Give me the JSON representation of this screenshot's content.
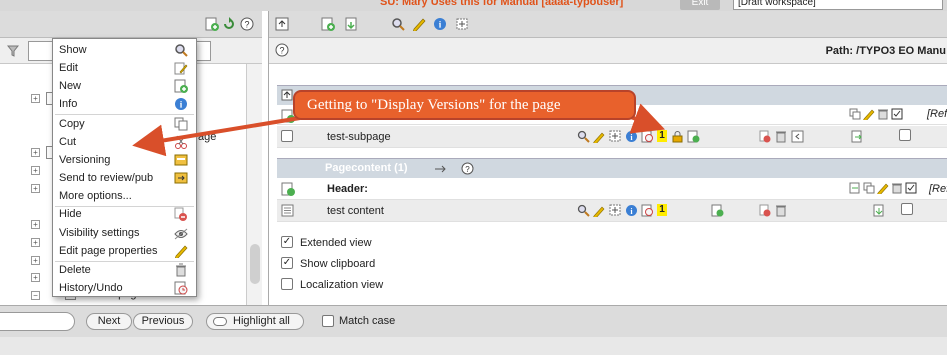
{
  "topbar": {
    "su_label": "SU:  Mary Uses this for Manual [aaaa-typouser]",
    "exit_label": "Exit",
    "workspace": "[Draft workspace]"
  },
  "context_menu": {
    "items": [
      {
        "label": "Show",
        "icon": "magnifier-icon"
      },
      {
        "label": "Edit",
        "icon": "pencil-page-icon"
      },
      {
        "label": "New",
        "icon": "new-page-icon"
      },
      {
        "label": "Info",
        "icon": "info-icon"
      },
      {
        "label": "Copy",
        "icon": "copy-icon"
      },
      {
        "label": "Cut",
        "icon": "scissors-icon"
      },
      {
        "label": "Versioning",
        "icon": "versioning-icon"
      },
      {
        "label": "Send to review/pub",
        "icon": "send-review-icon"
      },
      {
        "label": "More options...",
        "icon": ""
      },
      {
        "label": "Hide",
        "icon": "hide-icon"
      },
      {
        "label": "Visibility settings",
        "icon": "visibility-icon"
      },
      {
        "label": "Edit page properties",
        "icon": "pencil-icon"
      },
      {
        "label": "Delete",
        "icon": "trash-icon"
      },
      {
        "label": "History/Undo",
        "icon": "history-icon"
      }
    ]
  },
  "tree": {
    "partial_text": "age",
    "subpage_label": "test-subpage"
  },
  "right": {
    "path_label": "Path: /TYPO3 EO Manu",
    "page_row_label": "test-subpage",
    "ref_label": "[Ref",
    "badge_value": "1",
    "section_title": "Pagecontent (1)",
    "header_label": "Header:",
    "content_label": "test content",
    "options": [
      {
        "label": "Extended view",
        "checked": true
      },
      {
        "label": "Show clipboard",
        "checked": true
      },
      {
        "label": "Localization view",
        "checked": false
      }
    ]
  },
  "callout": {
    "text": "Getting to \"Display Versions\" for the page",
    "color": "#e8612c"
  },
  "findbar": {
    "next_label": "Next",
    "previous_label": "Previous",
    "highlight_label": "Highlight all",
    "match_case_label": "Match case"
  }
}
